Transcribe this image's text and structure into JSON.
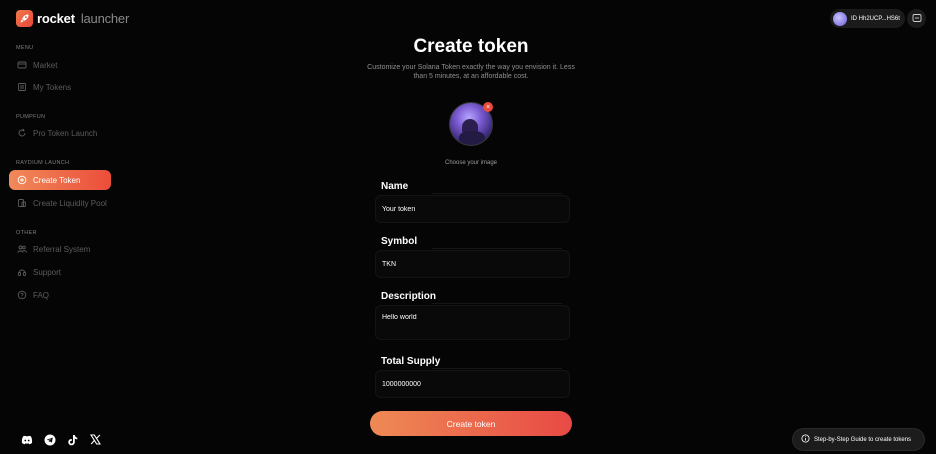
{
  "brand": {
    "name": "rocket",
    "sub": "launcher"
  },
  "sidebar": {
    "menu_title": "MENU",
    "menu_items": [
      {
        "label": "Market",
        "icon": "market-icon"
      },
      {
        "label": "My Tokens",
        "icon": "tokens-icon"
      }
    ],
    "pumpfun_title": "PUMPFUN",
    "pumpfun_items": [
      {
        "label": "Pro Token Launch",
        "icon": "refresh-icon"
      }
    ],
    "raydium_title": "RAYDIUM LAUNCH",
    "raydium_items": [
      {
        "label": "Create Token",
        "icon": "plus-circle-icon",
        "active": true
      },
      {
        "label": "Create Liquidity Pool",
        "icon": "pool-icon"
      }
    ],
    "other_title": "OTHER",
    "other_items": [
      {
        "label": "Referral System",
        "icon": "users-icon"
      },
      {
        "label": "Support",
        "icon": "support-icon"
      },
      {
        "label": "FAQ",
        "icon": "help-icon"
      }
    ],
    "socials": [
      "discord-icon",
      "telegram-icon",
      "tiktok-icon",
      "x-icon"
    ]
  },
  "wallet": {
    "label": "ID Hh2UCP...HS6t"
  },
  "main": {
    "title": "Create token",
    "subtitle": "Customize your Solana Token exactly the way you envision it. Less than 5 minutes, at an affordable cost.",
    "choose_image_label": "Choose your image",
    "fields": {
      "name": {
        "label": "Name",
        "value": "Your token"
      },
      "symbol": {
        "label": "Symbol",
        "value": "TKN"
      },
      "description": {
        "label": "Description",
        "value": "Hello world"
      },
      "supply": {
        "label": "Total Supply",
        "value": "1000000000"
      }
    },
    "submit_label": "Create token"
  },
  "guide": {
    "label": "Step-by-Step Guide to create tokens"
  },
  "colors": {
    "accent_start": "#f08a5a",
    "accent_end": "#e84a3c",
    "background": "#050505"
  }
}
